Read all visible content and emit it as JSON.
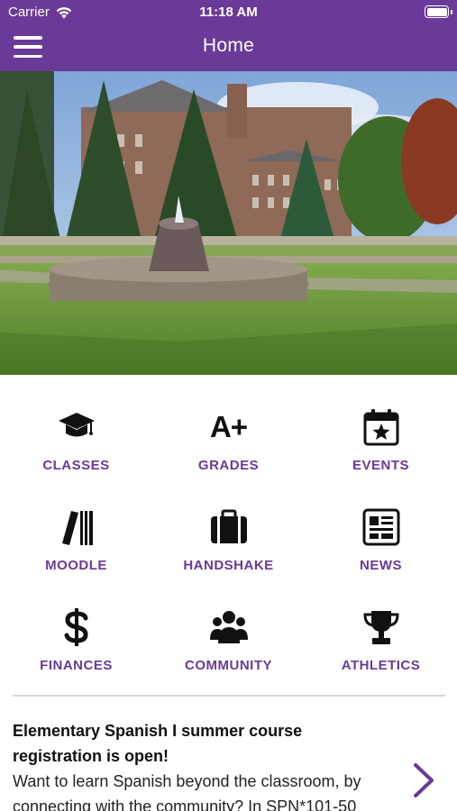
{
  "status_bar": {
    "carrier": "Carrier",
    "time": "11:18 AM"
  },
  "nav": {
    "title": "Home"
  },
  "tiles": [
    {
      "label": "CLASSES",
      "icon": "graduation-cap-icon"
    },
    {
      "label": "GRADES",
      "icon": "a-plus-icon"
    },
    {
      "label": "EVENTS",
      "icon": "calendar-star-icon"
    },
    {
      "label": "MOODLE",
      "icon": "books-icon"
    },
    {
      "label": "HANDSHAKE",
      "icon": "briefcase-icon"
    },
    {
      "label": "NEWS",
      "icon": "newspaper-icon"
    },
    {
      "label": "FINANCES",
      "icon": "dollar-icon"
    },
    {
      "label": "COMMUNITY",
      "icon": "people-icon"
    },
    {
      "label": "ATHLETICS",
      "icon": "trophy-icon"
    }
  ],
  "grades_glyph": "A+",
  "news": {
    "title_line1": "Elementary Spanish I summer course",
    "title_line2": "registration is open!",
    "body_line1": "Want to learn Spanish beyond the classroom, by",
    "body_line2": "connecting with the community? In SPN*101-50"
  },
  "colors": {
    "brand": "#6a3a98",
    "icon": "#111111"
  }
}
